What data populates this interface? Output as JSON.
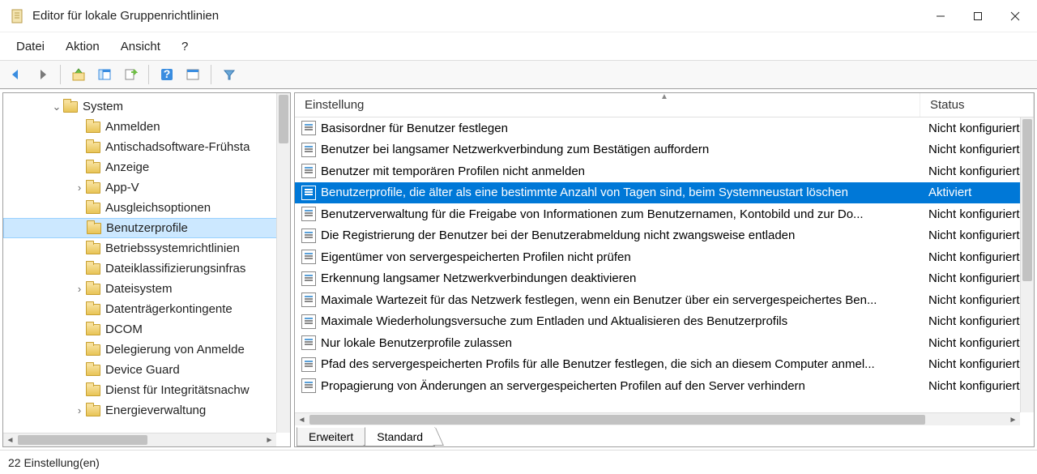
{
  "window": {
    "title": "Editor für lokale Gruppenrichtlinien"
  },
  "menu": {
    "file": "Datei",
    "action": "Aktion",
    "view": "Ansicht",
    "help": "?"
  },
  "tree": {
    "root": "System",
    "items": [
      {
        "label": "Anmelden",
        "indent": 2,
        "tw": ""
      },
      {
        "label": "Antischadsoftware-Frühsta",
        "indent": 2,
        "tw": ""
      },
      {
        "label": "Anzeige",
        "indent": 2,
        "tw": ""
      },
      {
        "label": "App-V",
        "indent": 2,
        "tw": "›"
      },
      {
        "label": "Ausgleichsoptionen",
        "indent": 2,
        "tw": ""
      },
      {
        "label": "Benutzerprofile",
        "indent": 2,
        "tw": "",
        "selected": true
      },
      {
        "label": "Betriebssystemrichtlinien",
        "indent": 2,
        "tw": ""
      },
      {
        "label": "Dateiklassifizierungsinfras",
        "indent": 2,
        "tw": ""
      },
      {
        "label": "Dateisystem",
        "indent": 2,
        "tw": "›"
      },
      {
        "label": "Datenträgerkontingente",
        "indent": 2,
        "tw": ""
      },
      {
        "label": "DCOM",
        "indent": 2,
        "tw": ""
      },
      {
        "label": "Delegierung von Anmelde",
        "indent": 2,
        "tw": ""
      },
      {
        "label": "Device Guard",
        "indent": 2,
        "tw": ""
      },
      {
        "label": "Dienst für Integritätsnachw",
        "indent": 2,
        "tw": ""
      },
      {
        "label": "Energieverwaltung",
        "indent": 2,
        "tw": "›"
      }
    ]
  },
  "list": {
    "header_setting": "Einstellung",
    "header_status": "Status",
    "rows": [
      {
        "name": "Basisordner für Benutzer festlegen",
        "status": "Nicht konfiguriert"
      },
      {
        "name": "Benutzer bei langsamer Netzwerkverbindung zum Bestätigen auffordern",
        "status": "Nicht konfiguriert"
      },
      {
        "name": "Benutzer mit temporären Profilen nicht anmelden",
        "status": "Nicht konfiguriert"
      },
      {
        "name": "Benutzerprofile, die älter als eine bestimmte Anzahl von Tagen sind, beim Systemneustart löschen",
        "status": "Aktiviert",
        "selected": true
      },
      {
        "name": "Benutzerverwaltung für die Freigabe von Informationen zum Benutzernamen, Kontobild und zur Do...",
        "status": "Nicht konfiguriert"
      },
      {
        "name": "Die Registrierung der Benutzer bei der Benutzerabmeldung nicht zwangsweise entladen",
        "status": "Nicht konfiguriert"
      },
      {
        "name": "Eigentümer von servergespeicherten Profilen nicht prüfen",
        "status": "Nicht konfiguriert"
      },
      {
        "name": "Erkennung langsamer Netzwerkverbindungen deaktivieren",
        "status": "Nicht konfiguriert"
      },
      {
        "name": "Maximale Wartezeit für das Netzwerk festlegen, wenn ein Benutzer über ein servergespeichertes Ben...",
        "status": "Nicht konfiguriert"
      },
      {
        "name": "Maximale Wiederholungsversuche zum Entladen und Aktualisieren des Benutzerprofils",
        "status": "Nicht konfiguriert"
      },
      {
        "name": "Nur lokale Benutzerprofile zulassen",
        "status": "Nicht konfiguriert"
      },
      {
        "name": "Pfad des servergespeicherten Profils für alle Benutzer festlegen, die sich an diesem Computer anmel...",
        "status": "Nicht konfiguriert"
      },
      {
        "name": "Propagierung von Änderungen an servergespeicherten Profilen auf den Server verhindern",
        "status": "Nicht konfiguriert"
      }
    ]
  },
  "tabs": {
    "extended": "Erweitert",
    "standard": "Standard"
  },
  "statusbar": {
    "text": "22 Einstellung(en)"
  }
}
